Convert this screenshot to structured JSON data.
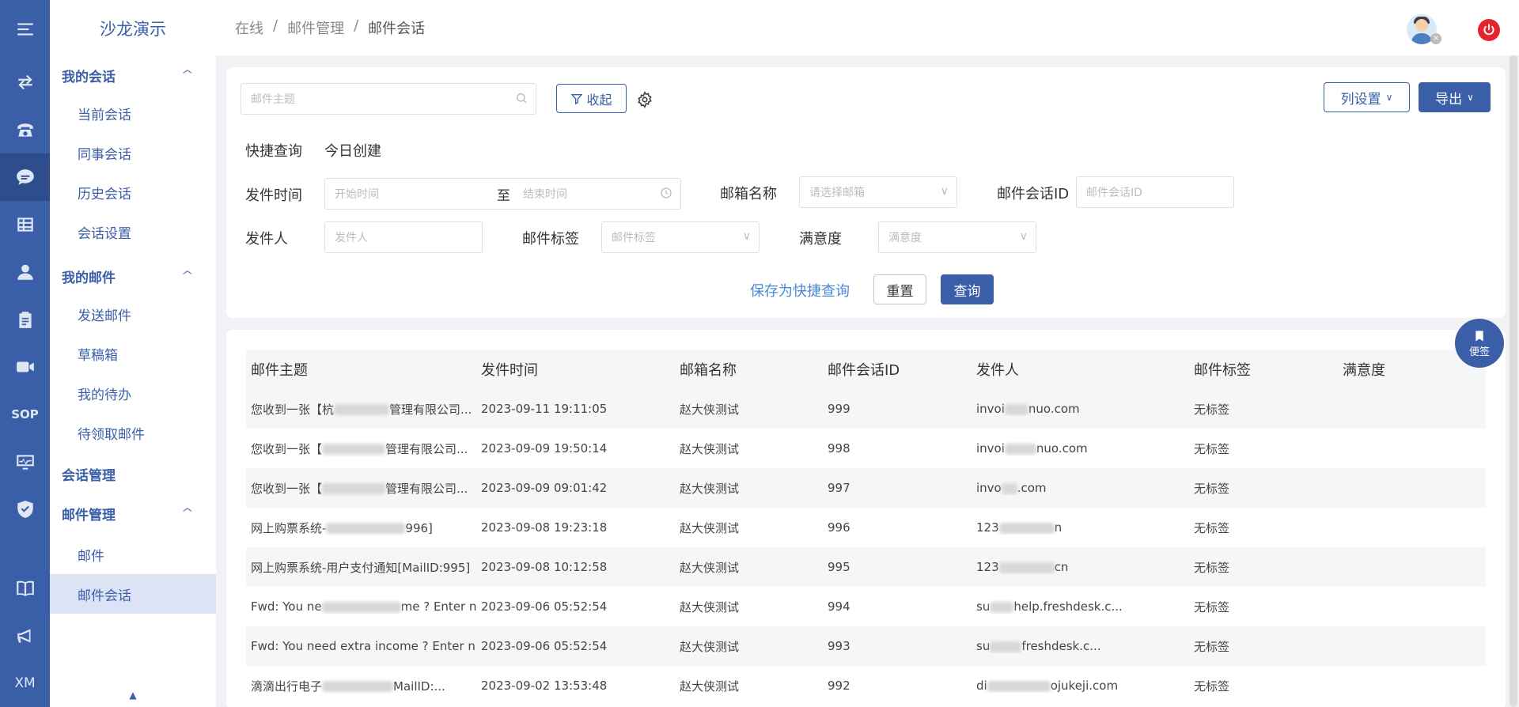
{
  "app": {
    "title": "沙龙演示"
  },
  "rail": {
    "bottom_text": "XM",
    "sop_text": "SOP"
  },
  "nav": {
    "groups": [
      {
        "label": "我的会话",
        "items": [
          "当前会话",
          "同事会话",
          "历史会话",
          "会话设置"
        ]
      },
      {
        "label": "我的邮件",
        "items": [
          "发送邮件",
          "草稿箱",
          "我的待办",
          "待领取邮件"
        ]
      },
      {
        "label": "会话管理"
      },
      {
        "label": "邮件管理",
        "items": [
          "邮件",
          "邮件会话"
        ]
      }
    ],
    "active_item": "邮件会话"
  },
  "breadcrumb": {
    "items": [
      "在线",
      "邮件管理",
      "邮件会话"
    ],
    "separator": "/"
  },
  "filters": {
    "subject_placeholder": "邮件主题",
    "collapse_label": "收起",
    "column_settings_label": "列设置",
    "export_label": "导出",
    "quick_query_label": "快捷查询",
    "quick_query_value": "今日创建",
    "send_time_label": "发件时间",
    "start_placeholder": "开始时间",
    "range_sep": "至",
    "end_placeholder": "结束时间",
    "mailbox_label": "邮箱名称",
    "mailbox_placeholder": "请选择邮箱",
    "session_id_label": "邮件会话ID",
    "session_id_placeholder": "邮件会话ID",
    "sender_label": "发件人",
    "sender_placeholder": "发件人",
    "tag_label": "邮件标签",
    "tag_placeholder": "邮件标签",
    "satisfaction_label": "满意度",
    "satisfaction_placeholder": "满意度",
    "save_quick_label": "保存为快捷查询",
    "reset_label": "重置",
    "query_label": "查询"
  },
  "table": {
    "headers": [
      "邮件主题",
      "发件时间",
      "邮箱名称",
      "邮件会话ID",
      "发件人",
      "邮件标签",
      "满意度"
    ],
    "rows": [
      [
        "您收到一张【杭",
        "2023-09-11 19:11:05",
        "赵大侠测试",
        "999",
        "invoi",
        "无标签",
        "",
        "管理有限公司...",
        "nuo.com"
      ],
      [
        "您收到一张【",
        "2023-09-09 19:50:14",
        "赵大侠测试",
        "998",
        "invoi",
        "无标签",
        "",
        "管理有限公司...",
        "nuo.com"
      ],
      [
        "您收到一张【",
        "2023-09-09 09:01:42",
        "赵大侠测试",
        "997",
        "invo",
        "无标签",
        "",
        "管理有限公司...",
        ".com"
      ],
      [
        "网上购票系统-",
        "2023-09-08 19:23:18",
        "赵大侠测试",
        "996",
        "123",
        "无标签",
        "",
        "996]",
        "n"
      ],
      [
        "网上购票系统-用户支付通知[MailID:995]",
        "2023-09-08 10:12:58",
        "赵大侠测试",
        "995",
        "123",
        "无标签",
        "",
        "",
        "cn"
      ],
      [
        "Fwd: You ne",
        "2023-09-06 05:52:54",
        "赵大侠测试",
        "994",
        "su",
        "无标签",
        "",
        "me ? Enter n...",
        "help.freshdesk.c..."
      ],
      [
        "Fwd: You need extra income ? Enter n...",
        "2023-09-06 05:52:54",
        "赵大侠测试",
        "993",
        "su",
        "无标签",
        "",
        "",
        "freshdesk.c..."
      ],
      [
        "滴滴出行电子",
        "2023-09-02 13:53:48",
        "赵大侠测试",
        "992",
        "di",
        "无标签",
        "",
        "MailID:...",
        "ojukeji.com"
      ]
    ]
  },
  "sticky": {
    "label": "便签"
  }
}
